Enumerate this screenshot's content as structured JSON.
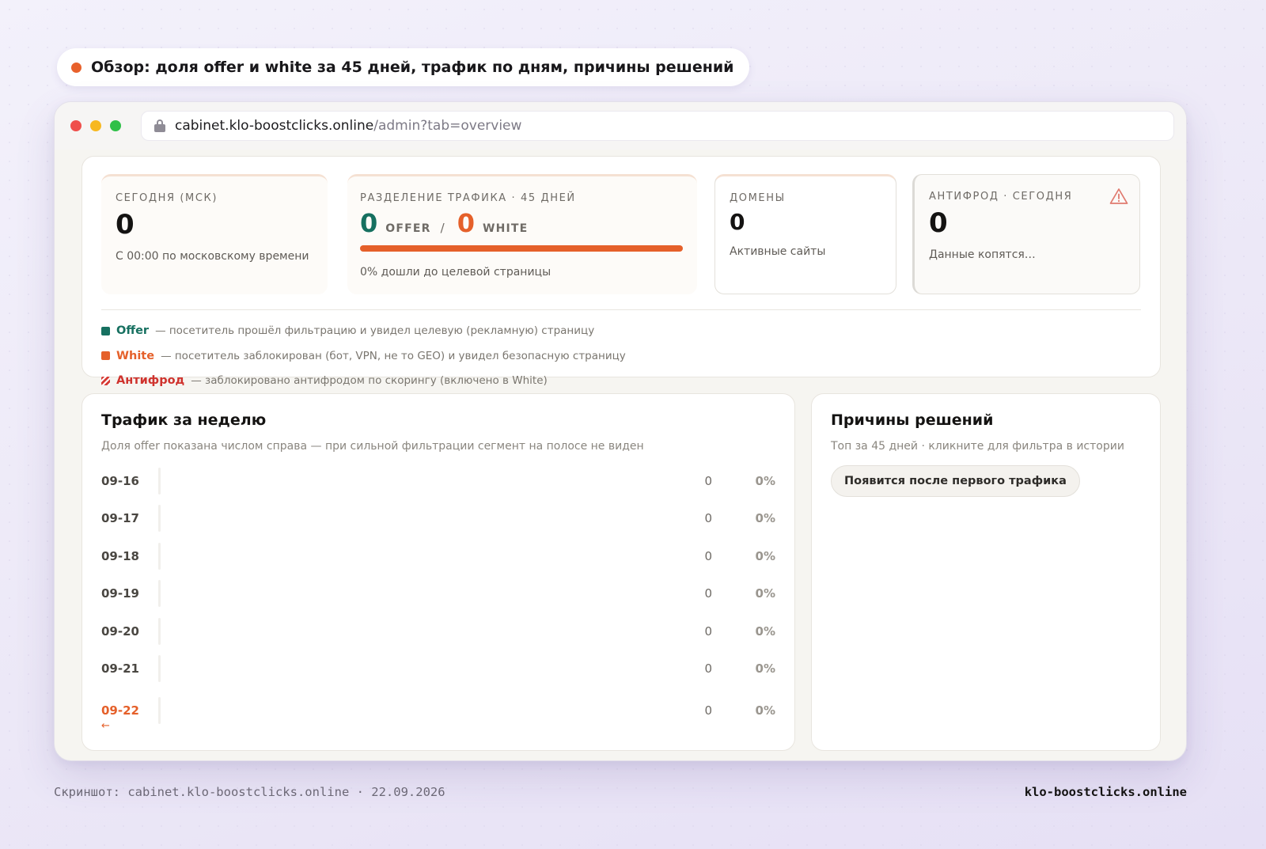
{
  "caption": {
    "text": "Обзор: доля offer и white за 45 дней, трафик по дням, причины решений"
  },
  "browser": {
    "url_host": "cabinet.klo-boostclicks.online",
    "url_path": "/admin?tab=overview"
  },
  "stats": {
    "today": {
      "label": "Сегодня (МСК)",
      "value": "0",
      "sub": "С 00:00 по московскому времени"
    },
    "split": {
      "label": "Разделение трафика · 45 дней",
      "offer_value": "0",
      "offer_label": "OFFER",
      "sep": "/",
      "white_value": "0",
      "white_label": "WHITE",
      "sub": "0% дошли до целевой страницы"
    },
    "domains": {
      "label": "Домены",
      "value": "0",
      "sub": "Активные сайты"
    },
    "antifraud": {
      "label": "Антифрод · сегодня",
      "value": "0",
      "sub": "Данные копятся…",
      "icon": "warning-icon"
    }
  },
  "legend": [
    {
      "key": "offer",
      "name": "Offer",
      "desc": "— посетитель прошёл фильтрацию и увидел целевую (рекламную) страницу"
    },
    {
      "key": "white",
      "name": "White",
      "desc": "— посетитель заблокирован (бот, VPN, не то GEO) и увидел безопасную страницу"
    },
    {
      "key": "af",
      "name": "Антифрод",
      "desc": "— заблокировано антифродом по скорингу (включено в White)"
    }
  ],
  "traffic": {
    "title": "Трафик за неделю",
    "subtitle": "Доля offer показана числом справа — при сильной фильтрации сегмент на полосе не виден",
    "rows": [
      {
        "date": "09-16",
        "count": "0",
        "pct": "0%"
      },
      {
        "date": "09-17",
        "count": "0",
        "pct": "0%"
      },
      {
        "date": "09-18",
        "count": "0",
        "pct": "0%"
      },
      {
        "date": "09-19",
        "count": "0",
        "pct": "0%"
      },
      {
        "date": "09-20",
        "count": "0",
        "pct": "0%"
      },
      {
        "date": "09-21",
        "count": "0",
        "pct": "0%"
      },
      {
        "date": "09-22",
        "count": "0",
        "pct": "0%",
        "marker": "←"
      }
    ]
  },
  "reasons": {
    "title": "Причины решений",
    "subtitle": "Топ за 45 дней · кликните для фильтра в истории",
    "empty_button": "Появится после первого трафика"
  },
  "footer": {
    "left": "Скриншот: cabinet.klo-boostclicks.online · 22.09.2026",
    "right": "klo-boostclicks.online"
  },
  "colors": {
    "offer": "#167060",
    "white": "#e5602a",
    "antifraud": "#cf322d"
  }
}
